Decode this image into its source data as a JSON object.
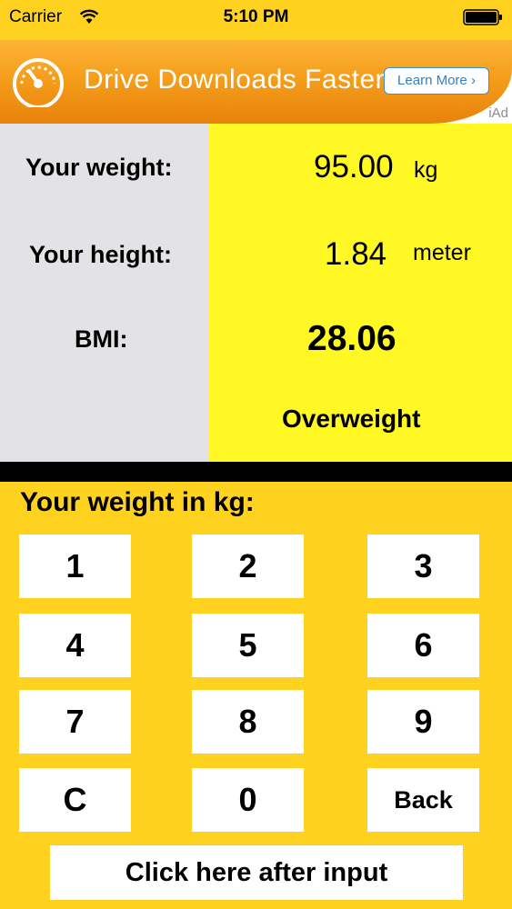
{
  "status_bar": {
    "carrier": "Carrier",
    "time": "5:10 PM",
    "wifi_icon": "wifi-icon",
    "battery_icon": "battery-icon"
  },
  "ad": {
    "headline": "Drive Downloads Faster",
    "cta_label": "Learn More",
    "badge": "iAd",
    "icon": "speedometer-icon",
    "colors": {
      "orange": "#f59e1b",
      "link_blue": "#2f7fc6"
    }
  },
  "results": {
    "weight_label": "Your weight:",
    "weight_value": "95.00",
    "weight_unit": "kg",
    "height_label": "Your height:",
    "height_value": "1.84",
    "height_unit": "meter",
    "bmi_label": "BMI:",
    "bmi_value": "28.06",
    "category": "Overweight",
    "colors": {
      "label_bg": "#e3e3e6",
      "value_bg": "#fff825"
    }
  },
  "keypad": {
    "title": "Your weight in kg:",
    "keys": [
      "1",
      "2",
      "3",
      "4",
      "5",
      "6",
      "7",
      "8",
      "9",
      "C",
      "0",
      "Back"
    ],
    "submit_label": "Click here after input",
    "colors": {
      "background": "#ffd21f",
      "key_bg": "#ffffff"
    }
  }
}
